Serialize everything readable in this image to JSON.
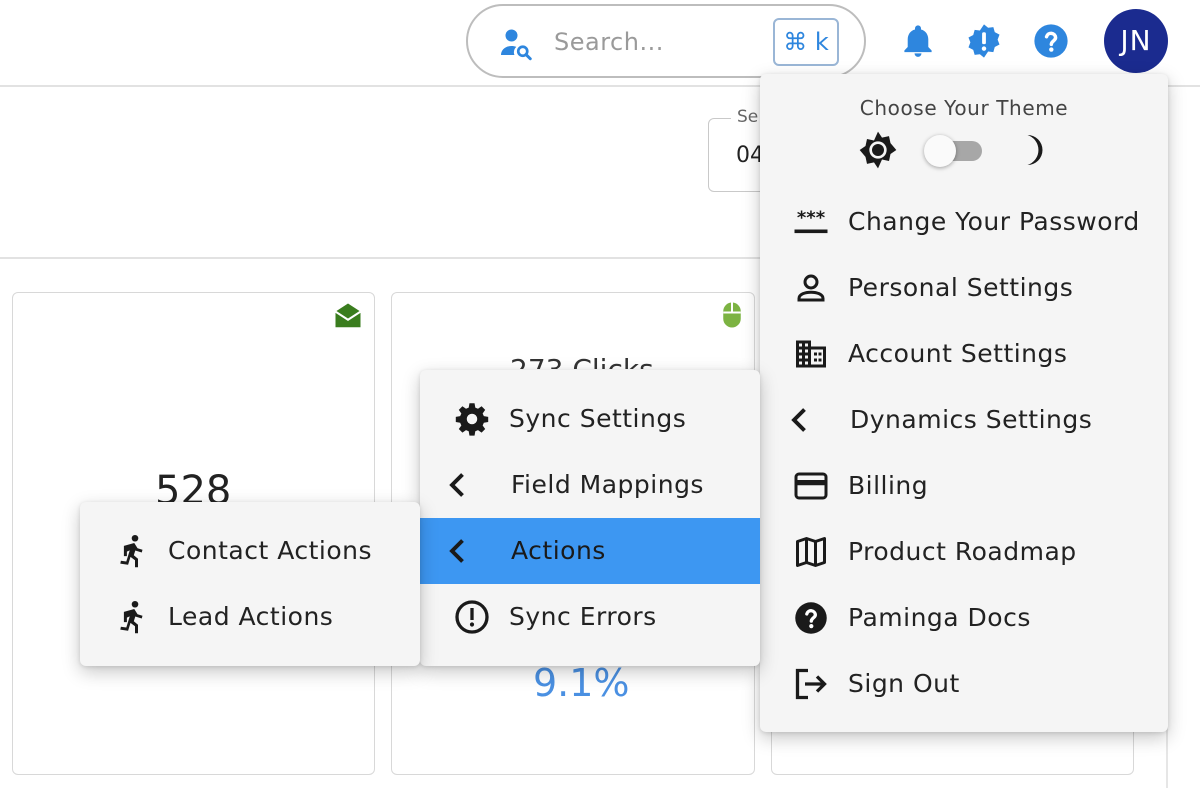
{
  "header": {
    "search_placeholder": "Search...",
    "search_shortcut": "⌘ k",
    "avatar_initials": "JN",
    "accent_color": "#2e86de"
  },
  "page": {
    "date_field_label": "Se",
    "date_field_value": "04",
    "card1_value": "528",
    "card2_title_partial": "273 Clicks",
    "card2_percent": "9.1%"
  },
  "account_menu": {
    "theme_label": "Choose Your Theme",
    "items": [
      {
        "label": "Change Your Password",
        "icon": "password-icon"
      },
      {
        "label": "Personal Settings",
        "icon": "person-icon"
      },
      {
        "label": "Account Settings",
        "icon": "building-icon"
      },
      {
        "label": "Dynamics Settings",
        "icon": "chevron-left-icon"
      },
      {
        "label": "Billing",
        "icon": "credit-card-icon"
      },
      {
        "label": "Product Roadmap",
        "icon": "map-icon"
      },
      {
        "label": "Paminga Docs",
        "icon": "help-circle-icon"
      },
      {
        "label": "Sign Out",
        "icon": "sign-out-icon"
      }
    ]
  },
  "dynamics_menu": {
    "items": [
      {
        "label": "Sync Settings",
        "icon": "gear-icon"
      },
      {
        "label": "Field Mappings",
        "icon": "chevron-left-icon"
      },
      {
        "label": "Actions",
        "icon": "chevron-left-icon",
        "active": true
      },
      {
        "label": "Sync Errors",
        "icon": "error-circle-icon"
      }
    ]
  },
  "actions_menu": {
    "items": [
      {
        "label": "Contact Actions",
        "icon": "running-person-icon"
      },
      {
        "label": "Lead Actions",
        "icon": "running-person-icon"
      }
    ]
  },
  "colors": {
    "active_item": "#3d97f2",
    "avatar_bg": "#1b2b8f",
    "icon_blue": "#2e86de",
    "email_icon": "#3a7d1e",
    "mouse_icon": "#7cb342",
    "percent_text": "#4a90e2"
  }
}
